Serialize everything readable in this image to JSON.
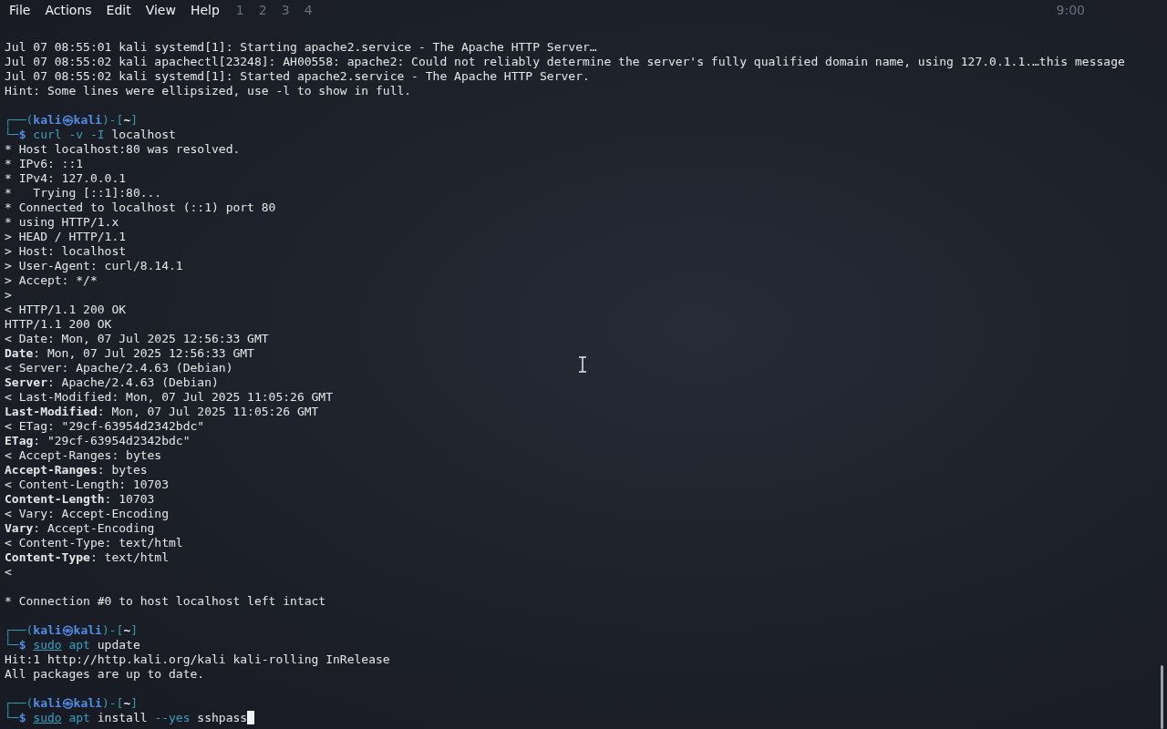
{
  "menu": [
    "File",
    "Actions",
    "Edit",
    "View",
    "Help"
  ],
  "panel": {
    "workspaces": [
      "1",
      "2",
      "3",
      "4"
    ],
    "clock": "9:00"
  },
  "lines": [
    {
      "kind": "text",
      "text": "Jul 07 08:55:01 kali systemd[1]: Starting apache2.service - The Apache HTTP Server…"
    },
    {
      "kind": "text",
      "text": "Jul 07 08:55:02 kali apachectl[23248]: AH00558: apache2: Could not reliably determine the server's fully qualified domain name, using 127.0.1.1.…this message"
    },
    {
      "kind": "text",
      "text": "Jul 07 08:55:02 kali systemd[1]: Started apache2.service - The Apache HTTP Server."
    },
    {
      "kind": "text",
      "text": "Hint: Some lines were ellipsized, use -l to show in full."
    },
    {
      "kind": "blank"
    },
    {
      "kind": "prompt",
      "parts": [
        {
          "t": "┌──(",
          "kind": "frame"
        },
        {
          "t": "kali㉿kali",
          "kind": "user"
        },
        {
          "t": ")-[",
          "kind": "frame"
        },
        {
          "t": "~",
          "kind": "dir"
        },
        {
          "t": "]",
          "kind": "frame"
        }
      ]
    },
    {
      "kind": "command",
      "lead": [
        {
          "t": "└─",
          "kind": "frame"
        },
        {
          "t": "$",
          "kind": "user"
        }
      ],
      "tokens": [
        {
          "t": "curl",
          "kind": "program"
        },
        {
          "t": "-v",
          "kind": "option"
        },
        {
          "t": "-I",
          "kind": "option"
        },
        {
          "t": "localhost",
          "kind": "arg"
        }
      ],
      "cursor": false
    },
    {
      "kind": "text",
      "text": "* Host localhost:80 was resolved."
    },
    {
      "kind": "text",
      "text": "* IPv6: ::1"
    },
    {
      "kind": "text",
      "text": "* IPv4: 127.0.0.1"
    },
    {
      "kind": "text",
      "text": "*   Trying [::1]:80..."
    },
    {
      "kind": "text",
      "text": "* Connected to localhost (::1) port 80"
    },
    {
      "kind": "text",
      "text": "* using HTTP/1.x"
    },
    {
      "kind": "text",
      "text": "> HEAD / HTTP/1.1"
    },
    {
      "kind": "text",
      "text": "> Host: localhost"
    },
    {
      "kind": "text",
      "text": "> User-Agent: curl/8.14.1"
    },
    {
      "kind": "text",
      "text": "> Accept: */*"
    },
    {
      "kind": "text",
      "text": ">"
    },
    {
      "kind": "text",
      "text": "< HTTP/1.1 200 OK"
    },
    {
      "kind": "text",
      "text": "HTTP/1.1 200 OK"
    },
    {
      "kind": "text",
      "text": "< Date: Mon, 07 Jul 2025 12:56:33 GMT"
    },
    {
      "kind": "header",
      "key": "Date",
      "rest": ": Mon, 07 Jul 2025 12:56:33 GMT"
    },
    {
      "kind": "text",
      "text": "< Server: Apache/2.4.63 (Debian)"
    },
    {
      "kind": "header",
      "key": "Server",
      "rest": ": Apache/2.4.63 (Debian)"
    },
    {
      "kind": "text",
      "text": "< Last-Modified: Mon, 07 Jul 2025 11:05:26 GMT"
    },
    {
      "kind": "header",
      "key": "Last-Modified",
      "rest": ": Mon, 07 Jul 2025 11:05:26 GMT"
    },
    {
      "kind": "text",
      "text": "< ETag: \"29cf-63954d2342bdc\""
    },
    {
      "kind": "header",
      "key": "ETag",
      "rest": ": \"29cf-63954d2342bdc\""
    },
    {
      "kind": "text",
      "text": "< Accept-Ranges: bytes"
    },
    {
      "kind": "header",
      "key": "Accept-Ranges",
      "rest": ": bytes"
    },
    {
      "kind": "text",
      "text": "< Content-Length: 10703"
    },
    {
      "kind": "header",
      "key": "Content-Length",
      "rest": ": 10703"
    },
    {
      "kind": "text",
      "text": "< Vary: Accept-Encoding"
    },
    {
      "kind": "header",
      "key": "Vary",
      "rest": ": Accept-Encoding"
    },
    {
      "kind": "text",
      "text": "< Content-Type: text/html"
    },
    {
      "kind": "header",
      "key": "Content-Type",
      "rest": ": text/html"
    },
    {
      "kind": "text",
      "text": "<"
    },
    {
      "kind": "blank"
    },
    {
      "kind": "text",
      "text": "* Connection #0 to host localhost left intact"
    },
    {
      "kind": "blank"
    },
    {
      "kind": "prompt",
      "parts": [
        {
          "t": "┌──(",
          "kind": "frame"
        },
        {
          "t": "kali㉿kali",
          "kind": "user"
        },
        {
          "t": ")-[",
          "kind": "frame"
        },
        {
          "t": "~",
          "kind": "dir"
        },
        {
          "t": "]",
          "kind": "frame"
        }
      ]
    },
    {
      "kind": "command",
      "lead": [
        {
          "t": "└─",
          "kind": "frame"
        },
        {
          "t": "$",
          "kind": "user"
        }
      ],
      "tokens": [
        {
          "t": "sudo",
          "kind": "sudo"
        },
        {
          "t": "apt",
          "kind": "program"
        },
        {
          "t": "update",
          "kind": "arg"
        }
      ],
      "cursor": false
    },
    {
      "kind": "text",
      "text": "Hit:1 http://http.kali.org/kali kali-rolling InRelease"
    },
    {
      "kind": "text",
      "text": "All packages are up to date."
    },
    {
      "kind": "blank"
    },
    {
      "kind": "prompt",
      "parts": [
        {
          "t": "┌──(",
          "kind": "frame"
        },
        {
          "t": "kali㉿kali",
          "kind": "user"
        },
        {
          "t": ")-[",
          "kind": "frame"
        },
        {
          "t": "~",
          "kind": "dir"
        },
        {
          "t": "]",
          "kind": "frame"
        }
      ]
    },
    {
      "kind": "command",
      "lead": [
        {
          "t": "└─",
          "kind": "frame"
        },
        {
          "t": "$",
          "kind": "user"
        }
      ],
      "tokens": [
        {
          "t": "sudo",
          "kind": "sudo"
        },
        {
          "t": "apt",
          "kind": "program"
        },
        {
          "t": "install",
          "kind": "arg"
        },
        {
          "t": "--yes",
          "kind": "option"
        },
        {
          "t": "sshpass",
          "kind": "arg"
        }
      ],
      "cursor": true
    }
  ]
}
